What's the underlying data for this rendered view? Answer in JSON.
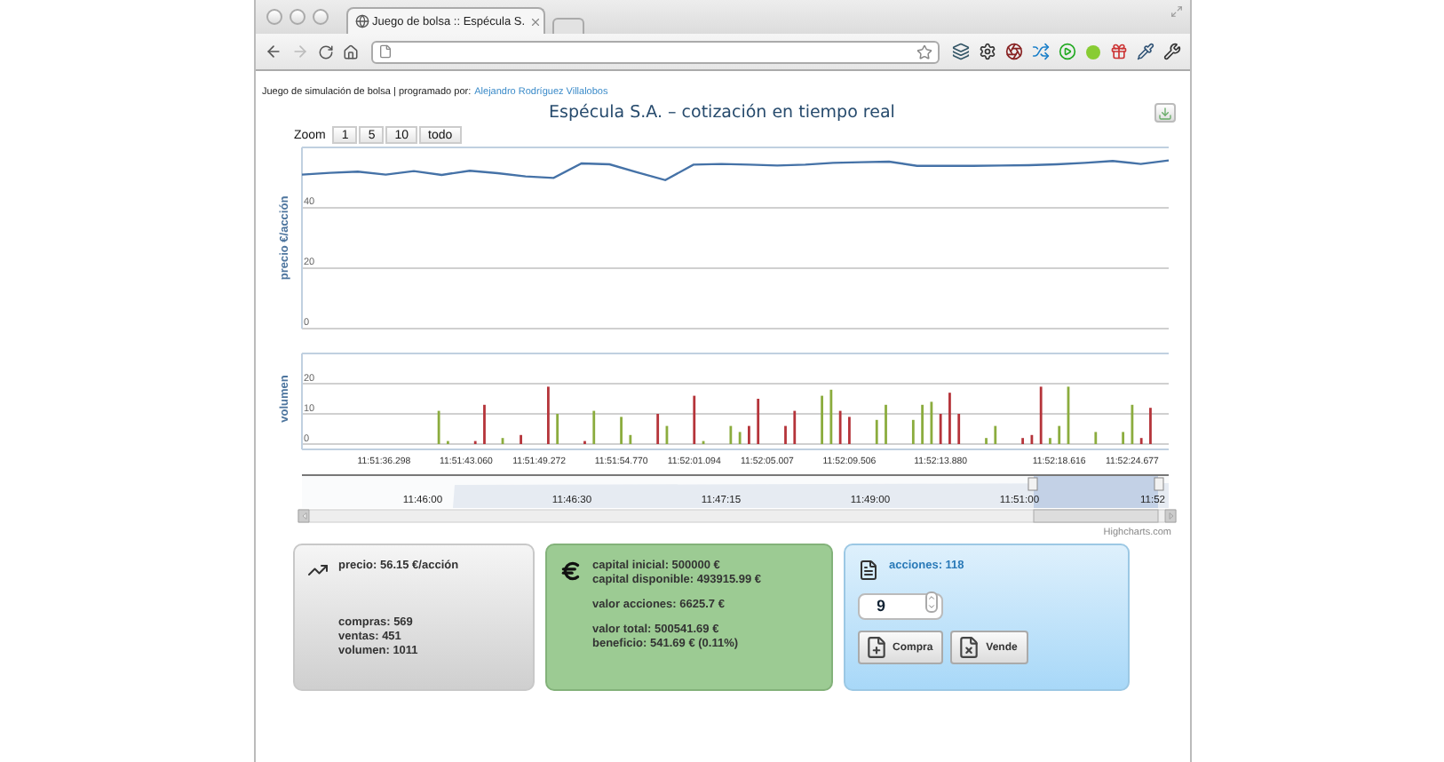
{
  "browser": {
    "tab": {
      "title": "Juego de bolsa :: Espécula S.",
      "selected": true
    }
  },
  "page": {
    "credit_text": "Juego de simulación de bolsa | programado por:",
    "author_link": "Alejandro Rodríguez Villalobos",
    "title": "Espécula S.A. – cotización en tiempo real"
  },
  "zoom": {
    "label": "Zoom",
    "buttons": [
      {
        "label": "1",
        "selected": false
      },
      {
        "label": "5",
        "selected": false
      },
      {
        "label": "10",
        "selected": false
      },
      {
        "label": "todo",
        "selected": false
      }
    ]
  },
  "price_chart": {
    "chart_data": {
      "type": "line",
      "ylabel": "precio €/acción",
      "ylim": [
        0,
        60
      ],
      "yticks": [
        0,
        20,
        40
      ],
      "categories": [
        null,
        null,
        null,
        null,
        null,
        null,
        null,
        null,
        null,
        null,
        null,
        null,
        null,
        null,
        null,
        null,
        null,
        null,
        null,
        null,
        null,
        null,
        null,
        null,
        null,
        null,
        null,
        null,
        null,
        null,
        null,
        null
      ],
      "series": [
        {
          "color": "#4572a7",
          "values": [
            51.0,
            51.6,
            52.0,
            51.0,
            52.2,
            50.9,
            52.3,
            51.5,
            50.4,
            49.9,
            54.7,
            54.4,
            51.7,
            49.2,
            54.3,
            54.5,
            54.3,
            54.0,
            54.3,
            54.9,
            55.1,
            55.3,
            53.9,
            53.9,
            53.9,
            54.0,
            54.1,
            54.4,
            54.9,
            55.5,
            54.5,
            55.7
          ]
        }
      ]
    }
  },
  "volume_chart": {
    "chart_data": {
      "type": "bar",
      "ylabel": "volumen",
      "ylim": [
        0,
        30
      ],
      "yticks": [
        0,
        10,
        20
      ],
      "categories": [
        null,
        null,
        null,
        null,
        null,
        null,
        null,
        null,
        null,
        "11:51:36.298",
        null,
        null,
        null,
        null,
        null,
        null,
        null,
        null,
        "11:51:43.060",
        null,
        null,
        null,
        null,
        null,
        null,
        null,
        "11:51:49.272",
        null,
        null,
        null,
        null,
        null,
        null,
        null,
        null,
        "11:51:54.770",
        null,
        null,
        null,
        null,
        null,
        null,
        null,
        "11:52:01.094",
        null,
        null,
        null,
        null,
        null,
        null,
        null,
        "11:52:05.007",
        null,
        null,
        null,
        null,
        null,
        null,
        null,
        null,
        "11:52:09.506",
        null,
        null,
        null,
        null,
        null,
        null,
        null,
        null,
        null,
        "11:52:13.880",
        null,
        null,
        null,
        null,
        null,
        null,
        null,
        null,
        null,
        null,
        null,
        null,
        "11:52:18.616",
        null,
        null,
        null,
        null,
        null,
        null,
        null,
        "11:52:24.677",
        null,
        null,
        null,
        null
      ],
      "series": [
        {
          "color": "#8bac3e",
          "values": [
            null,
            null,
            null,
            null,
            null,
            null,
            null,
            null,
            null,
            null,
            null,
            null,
            null,
            null,
            null,
            11,
            1,
            null,
            null,
            null,
            null,
            null,
            2,
            null,
            null,
            null,
            null,
            null,
            10,
            null,
            null,
            null,
            11,
            null,
            null,
            9,
            3,
            null,
            null,
            null,
            6,
            null,
            null,
            null,
            1,
            null,
            null,
            6,
            4,
            null,
            null,
            null,
            null,
            null,
            null,
            null,
            null,
            16,
            18,
            null,
            null,
            null,
            null,
            8,
            13,
            null,
            null,
            8,
            13,
            14,
            null,
            null,
            null,
            null,
            null,
            2,
            6,
            null,
            null,
            null,
            null,
            null,
            2,
            6,
            19,
            null,
            null,
            4,
            null,
            null,
            4,
            13,
            null,
            null,
            null,
            null
          ]
        },
        {
          "color": "#b5343a",
          "values": [
            null,
            null,
            null,
            null,
            null,
            null,
            null,
            null,
            null,
            null,
            null,
            null,
            null,
            null,
            null,
            null,
            null,
            null,
            null,
            1,
            13,
            null,
            null,
            null,
            3,
            null,
            null,
            19,
            null,
            null,
            null,
            1,
            null,
            null,
            null,
            null,
            null,
            null,
            null,
            10,
            null,
            null,
            null,
            16,
            null,
            null,
            null,
            null,
            null,
            6,
            15,
            null,
            null,
            6,
            11,
            null,
            null,
            null,
            null,
            11,
            9,
            null,
            null,
            null,
            null,
            null,
            null,
            null,
            null,
            null,
            10,
            17,
            10,
            null,
            null,
            null,
            null,
            null,
            null,
            2,
            3,
            19,
            null,
            null,
            null,
            null,
            null,
            null,
            null,
            null,
            null,
            null,
            2,
            12,
            null,
            null
          ]
        }
      ]
    }
  },
  "navigator": {
    "labels": [
      "11:46:00",
      "11:46:30",
      "11:47:15",
      "11:49:00",
      "11:51:00",
      "11:52"
    ],
    "credit": "Highcharts.com"
  },
  "market_card": {
    "price": "precio: 56.15 €/acción",
    "stats": [
      "compras: 569",
      "ventas: 451",
      "volumen: 1011"
    ]
  },
  "capital_card": {
    "groups": [
      [
        "capital inicial: 500000 €",
        "capital disponible: 493915.99 €"
      ],
      [
        "valor acciones: 6625.7 €"
      ],
      [
        "valor total: 500541.69 €",
        "beneficio: 541.69 € (0.11%)"
      ]
    ]
  },
  "trade_card": {
    "shares": "acciones: 118",
    "quantity": "9",
    "buttons": [
      {
        "kind": "buy",
        "label": "Compra"
      },
      {
        "kind": "sell",
        "label": "Vende"
      }
    ]
  }
}
